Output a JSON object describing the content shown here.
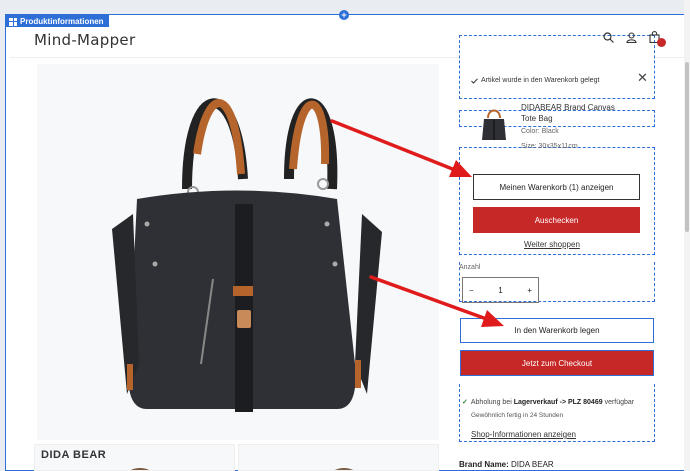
{
  "editor": {
    "section_tag": "Produktinformationen",
    "add_handle": "+"
  },
  "store": {
    "logo": "Mind-Mapper"
  },
  "header": {
    "icons": [
      "search-icon",
      "account-icon",
      "cart-icon"
    ]
  },
  "popup": {
    "message": "Artikel wurde in den Warenkorb gelegt",
    "close": "✕",
    "product_name": "DIDABEAR Brand Canvas Tote Bag",
    "color_label": "Color: Black",
    "size_label": "Size: 30x35x11cm",
    "view_cart": "Meinen Warenkorb (1) anzeigen",
    "checkout": "Auschecken",
    "continue": "Weiter shoppen"
  },
  "product": {
    "quantity_label": "Anzahl",
    "quantity": "1",
    "minus": "−",
    "plus": "+",
    "add_to_cart": "In den Warenkorb legen",
    "buy_now": "Jetzt zum Checkout",
    "pickup_prefix": "Abholung bei",
    "pickup_location": "Lagerverkauf -> PLZ 80469",
    "pickup_suffix": "verfügbar",
    "pickup_ready": "Gewöhnlich fertig in 24 Stunden",
    "shop_info": "Shop-Informationen anzeigen",
    "brand_label": "Brand Name:",
    "brand_value": "DIDA BEAR"
  },
  "gallery": {
    "thumb_label": "DIDA BEAR"
  },
  "colors": {
    "accent_blue": "#2d6fd6",
    "checkout_red": "#c62828",
    "arrow_red": "#e01b1b"
  }
}
